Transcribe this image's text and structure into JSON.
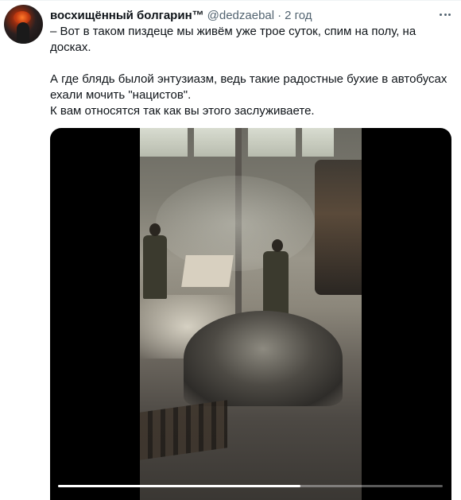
{
  "tweet": {
    "display_name": "восхищённый болгарин™",
    "handle": "@dedzaebal",
    "separator": "·",
    "time": "2 год",
    "text": [
      "– Вот в таком пиздеце мы живём уже трое суток, спим на полу, на досках.",
      "А где блядь былой энтузиазм, ведь такие радостные бухие в автобусах ехали мочить \"нацистов\".",
      "К вам относятся так как вы этого заслуживаете."
    ],
    "more_icon": "more-horizontal-icon",
    "avatar_icon": "avatar"
  },
  "media": {
    "type": "video",
    "progress": 0.63
  },
  "colors": {
    "text": "#0f1419",
    "secondary": "#536471",
    "background": "#ffffff"
  }
}
